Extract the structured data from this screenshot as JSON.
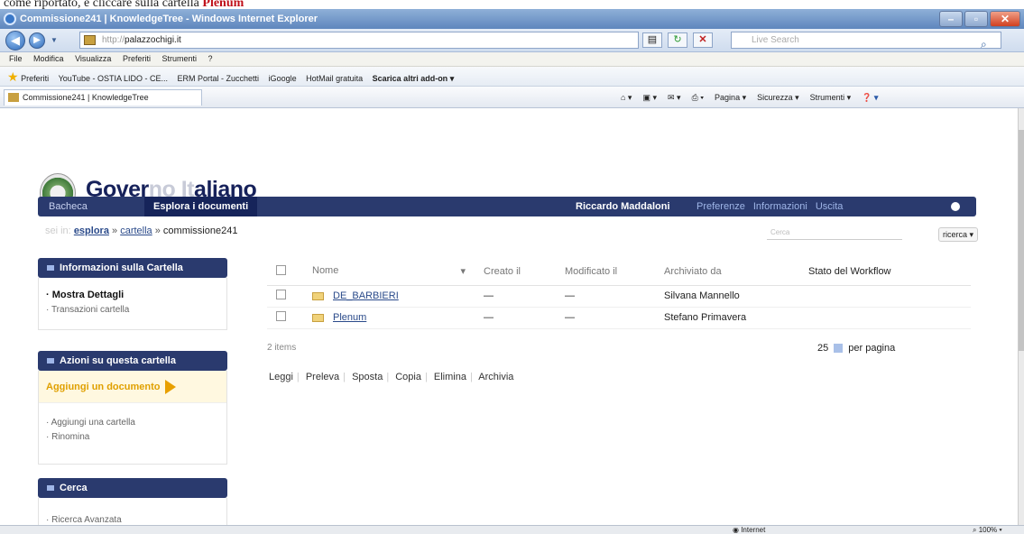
{
  "caption": {
    "text": "come riportato, e cliccare sulla cartella",
    "highlight": "Plenum"
  },
  "window": {
    "title": "Commissione241 | KnowledgeTree - Windows Internet Explorer"
  },
  "address": {
    "prefix": "http://",
    "domain": "palazzochigi.it",
    "search_placeholder": "Live Search"
  },
  "menubar": [
    "File",
    "Modifica",
    "Visualizza",
    "Preferiti",
    "Strumenti",
    "?"
  ],
  "favbar": [
    "Preferiti",
    "YouTube - OSTIA LIDO - CE...",
    "ERM Portal - Zucchetti",
    "iGoogle",
    "HotMail gratuita",
    "Scarica altri add-on"
  ],
  "tab_title": "Commissione241 | KnowledgeTree",
  "commands": [
    "Pagina",
    "Sicurezza",
    "Strumenti"
  ],
  "site": {
    "logo_part1": "Gover",
    "logo_fade1": "no ",
    "logo_fade2": "It",
    "logo_part2": "aliano"
  },
  "topnav": {
    "tab1": "Bacheca",
    "tab2": "Esplora i documenti",
    "user": "Riccardo Maddaloni",
    "links": [
      "Preferenze",
      "Informazioni",
      "Uscita"
    ]
  },
  "breadcrumb": {
    "prefix": "sei in:",
    "items": [
      "esplora",
      "cartella"
    ],
    "separator": "»",
    "current": "commissione241"
  },
  "search": {
    "placeholder": "Cerca",
    "button": "ricerca"
  },
  "panels": {
    "info": {
      "title": "Informazioni sulla Cartella",
      "items": [
        "Mostra Dettagli",
        "Transazioni cartella"
      ]
    },
    "actions": {
      "title": "Azioni su questa cartella",
      "add_document": "Aggiungi un documento",
      "items": [
        "Aggiungi una cartella",
        "Rinomina"
      ]
    },
    "search": {
      "title": "Cerca",
      "items": [
        "Ricerca Avanzata"
      ]
    }
  },
  "table": {
    "headers": [
      "Nome",
      "Creato il",
      "Modificato il",
      "Archiviato da",
      "Stato del Workflow"
    ],
    "rows": [
      {
        "name": "DE_BARBIERI",
        "created": "—",
        "modified": "—",
        "archived_by": "Silvana Mannello"
      },
      {
        "name": "Plenum",
        "created": "—",
        "modified": "—",
        "archived_by": "Stefano Primavera"
      }
    ],
    "item_count": "2 items",
    "per_page_value": "25",
    "per_page_label": "per pagina"
  },
  "bulk_actions": [
    "Leggi",
    "Preleva",
    "Sposta",
    "Copia",
    "Elimina",
    "Archivia"
  ],
  "statusbar": {
    "zone": "Internet",
    "zoom": "100%"
  }
}
